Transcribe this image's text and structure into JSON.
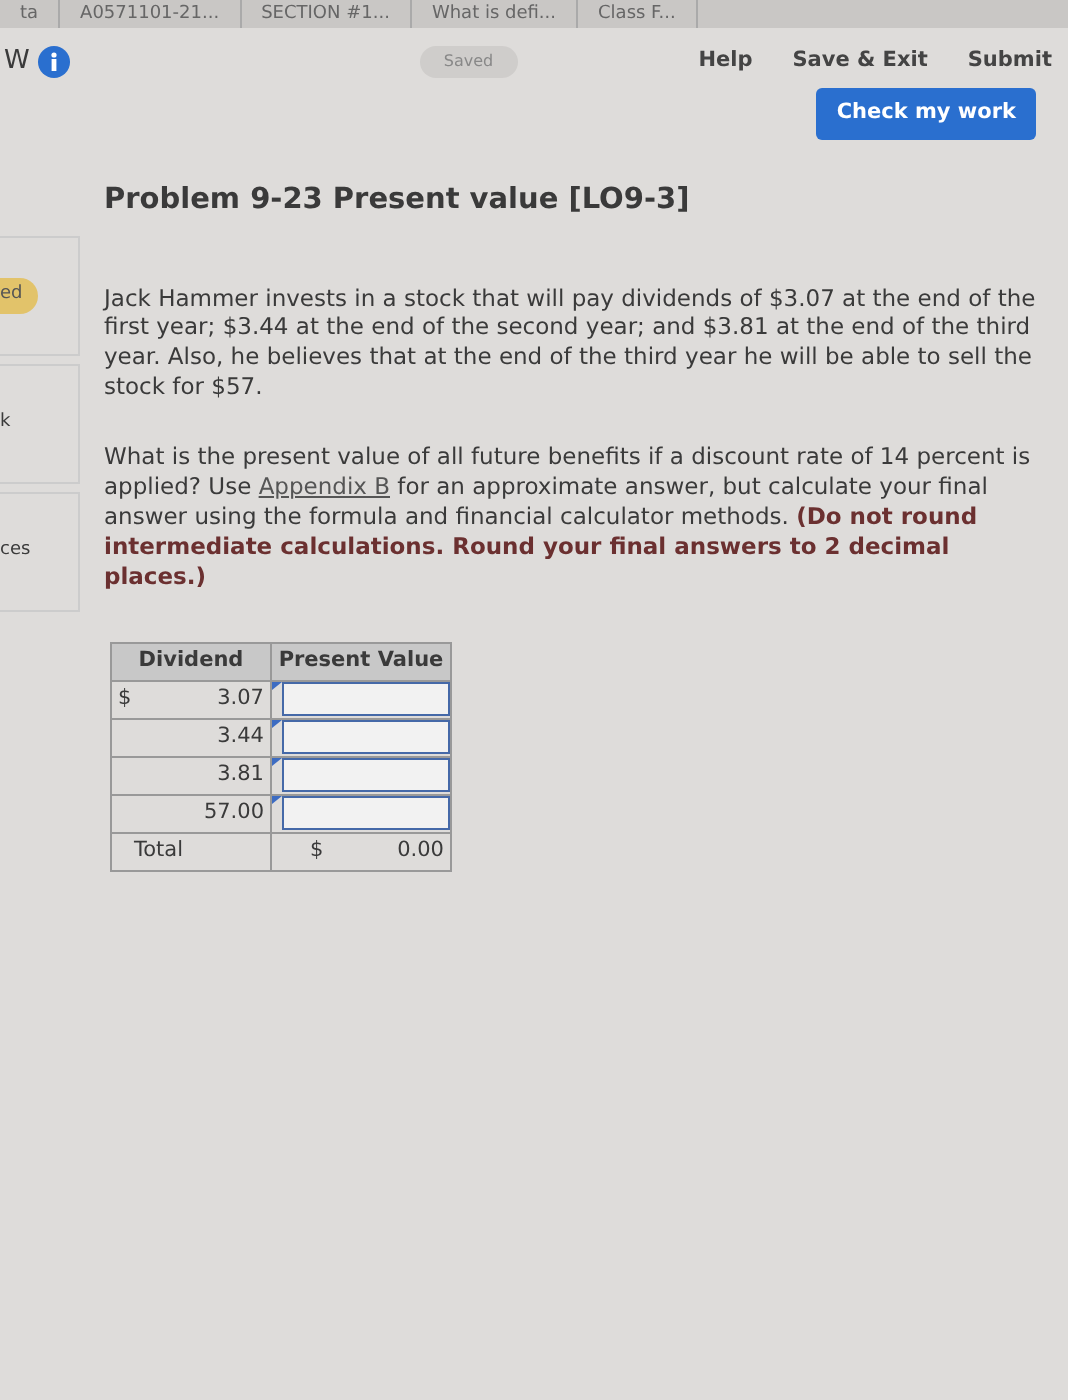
{
  "browser_tabs": [
    {
      "label": "ta"
    },
    {
      "label": "A0571101-21..."
    },
    {
      "label": "SECTION #1..."
    },
    {
      "label": "What is defi..."
    },
    {
      "label": "Class F..."
    }
  ],
  "header": {
    "left_text": "W",
    "status": "Saved",
    "links": [
      "Help",
      "Save & Exit",
      "Submit"
    ],
    "check_button": "Check my work"
  },
  "sidebar": {
    "items": [
      {
        "label": "ed",
        "highlighted": true
      },
      {
        "label": "k",
        "highlighted": false
      },
      {
        "label": "ces",
        "highlighted": false
      }
    ]
  },
  "problem": {
    "title": "Problem 9-23 Present value [LO9-3]",
    "paragraph_1": "Jack Hammer invests in a stock that will pay dividends of $3.07 at the end of the first year; $3.44 at the end of the second year; and $3.81 at the end of the third year. Also, he believes that at the end of the third year he will be able to sell the stock for $57.",
    "paragraph_2_start": "What is the present value of all future benefits if a discount rate of 14 percent is applied? Use",
    "link": "Appendix B",
    "paragraph_2_end": "for an approximate answer, but calculate your final answer using the formula and financial calculator methods. **(Do not round intermediate calculations. Round your final answers to 2 decimal places.)**"
  },
  "table": {
    "columns": [
      "Dividend",
      "Present Value"
    ],
    "rows": [
      {
        "currency": "$",
        "dividend": "3.07"
      },
      {
        "dividend": "3.44"
      },
      {
        "dividend": "3.81"
      },
      {
        "dividend": "57.00"
      }
    ],
    "total": {
      "label": "Total",
      "currency": "$",
      "value": "0.00"
    }
  }
}
